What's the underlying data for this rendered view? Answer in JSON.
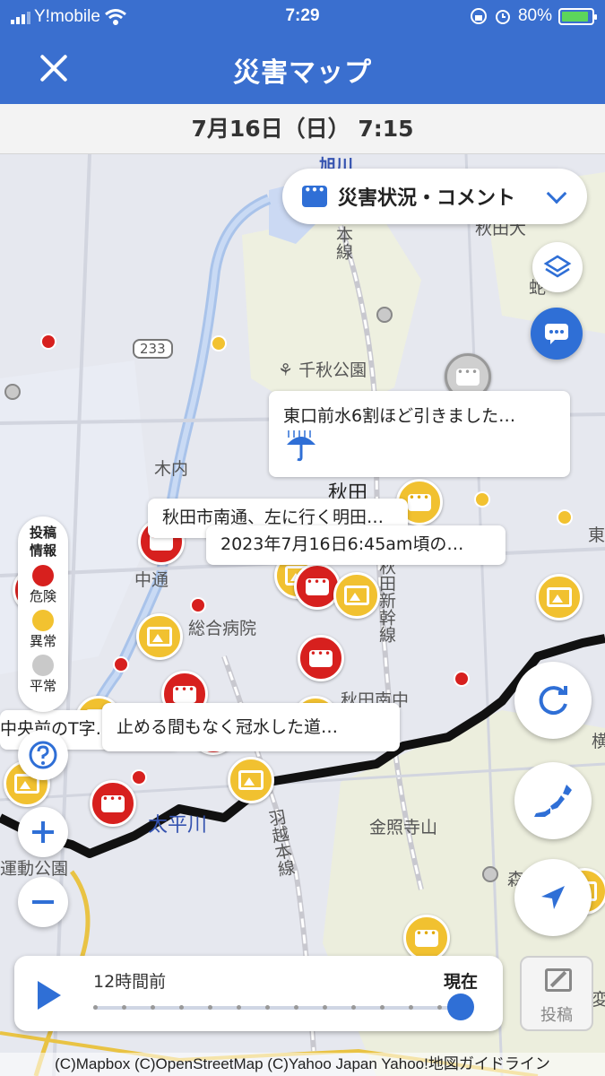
{
  "status": {
    "carrier": "Y!mobile",
    "time": "7:29",
    "battery": "80%"
  },
  "header": {
    "title": "災害マップ",
    "datetime": "7月16日（日） 7:15"
  },
  "filter": {
    "label": "災害状況・コメント"
  },
  "map_labels": {
    "asahikawa": "旭川",
    "ou_line": "本線",
    "akita_east": "秋田大",
    "chiaki_park": "千秋公園",
    "route_233": "233",
    "kubota": "木内",
    "akita_station": "秋田",
    "higashi": "東",
    "nakadori": "中通",
    "shinkansen": "秋田新幹線",
    "hospital": "総合病院",
    "minami_chu": "秋田南中",
    "yoko": "横",
    "taihei_river": "太平川",
    "uetsu_line": "羽越本線",
    "kinshoji": "金照寺山",
    "undo_park": "運動公園",
    "mori": "森",
    "kawaguchi": "変",
    "shiba": "蛇",
    "higashiguchi_text": "東通"
  },
  "callouts": {
    "c1": "東口前水6割ほど引きました…",
    "c2": "秋田市南通、左に行く明田…",
    "c3": "2023年7月16日6:45am頃の…",
    "c4": "中央前のT字…",
    "c5": "止める間もなく冠水した道…"
  },
  "legend": {
    "title": "投稿情報",
    "danger": "危険",
    "abnormal": "異常",
    "normal": "平常",
    "colors": {
      "danger": "#d7201e",
      "abnormal": "#f2c230",
      "normal": "#c9c9c9"
    }
  },
  "timeline": {
    "from": "12時間前",
    "now": "現在",
    "position": 1.0
  },
  "post_button": "投稿",
  "credits": "(C)Mapbox (C)OpenStreetMap (C)Yahoo Japan Yahoo!地図ガイドライン",
  "colors": {
    "accent": "#3a6fcf",
    "button_blue": "#2f6fd6"
  },
  "icons": [
    "close-icon",
    "comment-icon",
    "chevron-down-icon",
    "layers-icon",
    "refresh-icon",
    "japan-map-icon",
    "location-arrow-icon",
    "help-icon",
    "zoom-in-icon",
    "zoom-out-icon",
    "play-icon",
    "pencil-icon",
    "umbrella-icon",
    "image-icon"
  ]
}
